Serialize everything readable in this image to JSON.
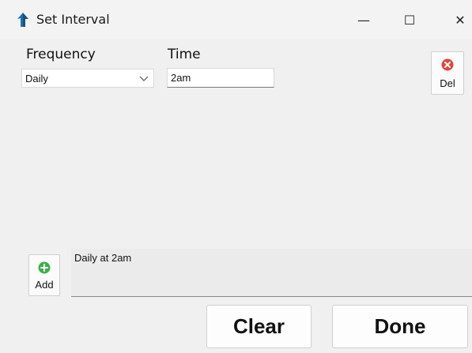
{
  "window": {
    "title": "Set Interval",
    "minimize": "—",
    "maximize": "☐",
    "close": "✕"
  },
  "form": {
    "frequency_label": "Frequency",
    "frequency_value": "Daily",
    "time_label": "Time",
    "time_value": "2am"
  },
  "buttons": {
    "del_label": "Del",
    "add_label": "Add",
    "clear_label": "Clear",
    "done_label": "Done"
  },
  "result": {
    "text": "Daily at 2am"
  },
  "colors": {
    "accent_blue": "#1f6fb2",
    "delete_red": "#e0463a",
    "add_green": "#3db04a"
  },
  "icons": {
    "app": "app-icon",
    "dropdown": "chevron-down-icon",
    "delete": "delete-icon",
    "add": "plus-circle-icon"
  }
}
